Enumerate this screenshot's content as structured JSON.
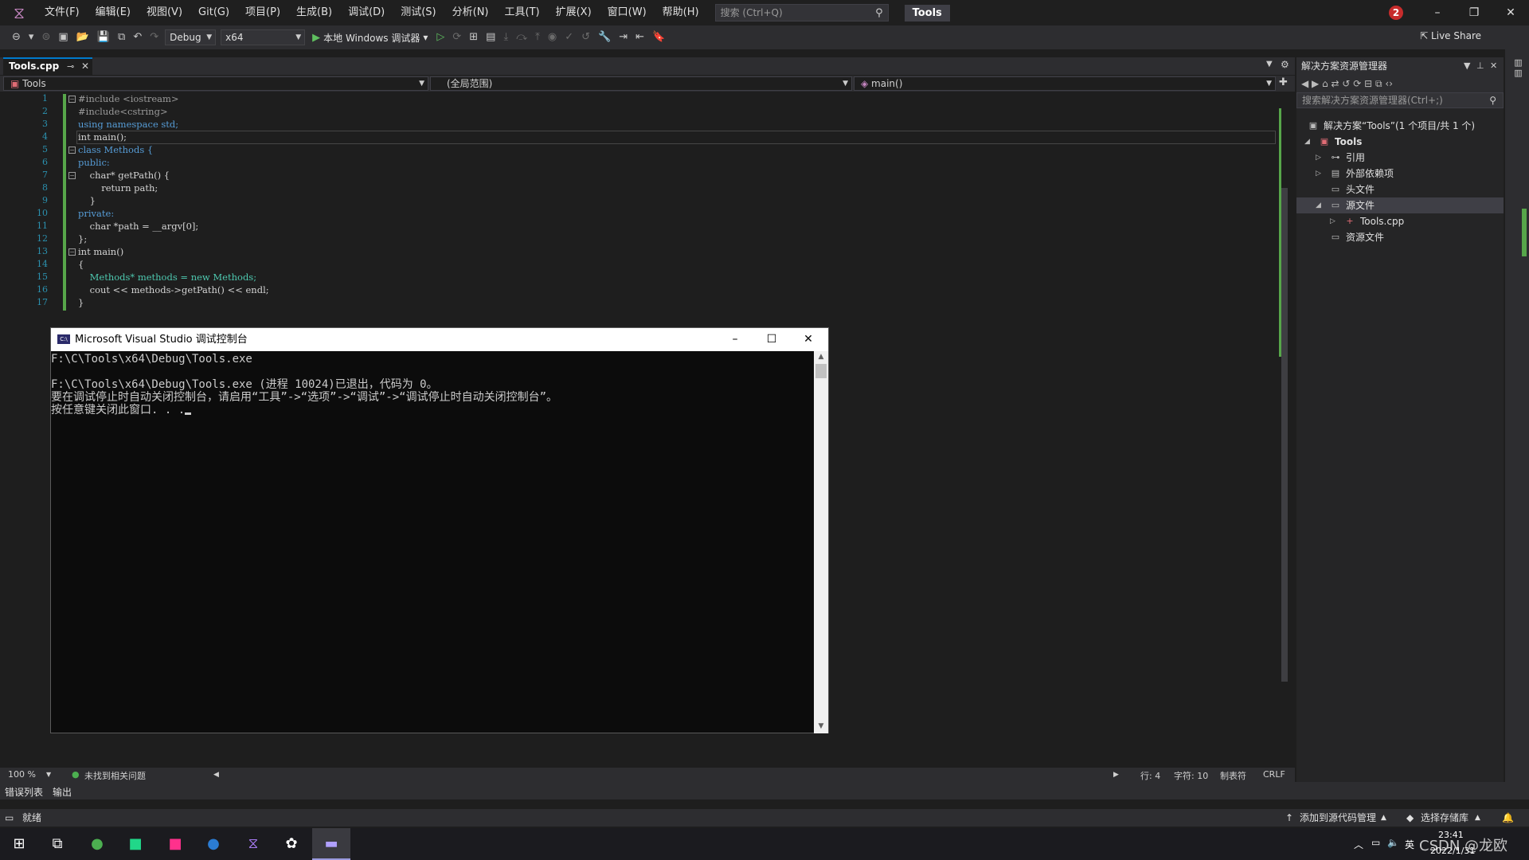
{
  "menubar": {
    "items": [
      "文件(F)",
      "编辑(E)",
      "视图(V)",
      "Git(G)",
      "项目(P)",
      "生成(B)",
      "调试(D)",
      "测试(S)",
      "分析(N)",
      "工具(T)",
      "扩展(X)",
      "窗口(W)",
      "帮助(H)"
    ],
    "search_placeholder": "搜索 (Ctrl+Q)",
    "solution_name": "Tools",
    "notification_count": "2"
  },
  "toolbar": {
    "config": "Debug",
    "platform": "x64",
    "run_label": "本地 Windows 调试器",
    "live_share": "Live Share"
  },
  "editor": {
    "tab_label": "Tools.cpp",
    "nav_project": "Tools",
    "nav_scope": "(全局范围)",
    "nav_member": "main()",
    "zoom": "100 %",
    "issues": "未找到相关问题",
    "line": "行: 4",
    "col": "字符: 10",
    "tabs": "制表符",
    "eol": "CRLF"
  },
  "code_lines": [
    {
      "n": "1",
      "t": "#include <iostream>"
    },
    {
      "n": "2",
      "t": "#include<cstring>"
    },
    {
      "n": "3",
      "t": "using namespace std;"
    },
    {
      "n": "4",
      "t": "int main();"
    },
    {
      "n": "5",
      "t": "class Methods {"
    },
    {
      "n": "6",
      "t": "public:"
    },
    {
      "n": "7",
      "t": "    char* getPath() {"
    },
    {
      "n": "8",
      "t": "        return path;"
    },
    {
      "n": "9",
      "t": "    }"
    },
    {
      "n": "10",
      "t": "private:"
    },
    {
      "n": "11",
      "t": "    char *path = __argv[0];"
    },
    {
      "n": "12",
      "t": "};"
    },
    {
      "n": "13",
      "t": "int main()"
    },
    {
      "n": "14",
      "t": "{"
    },
    {
      "n": "15",
      "t": "    Methods* methods = new Methods;"
    },
    {
      "n": "16",
      "t": "    cout << methods->getPath() << endl;"
    },
    {
      "n": "17",
      "t": "}"
    }
  ],
  "console": {
    "title": "Microsoft Visual Studio 调试控制台",
    "lines": [
      "F:\\C\\Tools\\x64\\Debug\\Tools.exe",
      "",
      "F:\\C\\Tools\\x64\\Debug\\Tools.exe (进程 10024)已退出，代码为 0。",
      "要在调试停止时自动关闭控制台，请启用“工具”->“选项”->“调试”->“调试停止时自动关闭控制台”。",
      "按任意键关闭此窗口. . ."
    ]
  },
  "solution_explorer": {
    "title": "解决方案资源管理器",
    "search_placeholder": "搜索解决方案资源管理器(Ctrl+;)",
    "items": [
      {
        "label": "解决方案“Tools”(1 个项目/共 1 个)"
      },
      {
        "label": "Tools"
      },
      {
        "label": "引用"
      },
      {
        "label": "外部依赖项"
      },
      {
        "label": "头文件"
      },
      {
        "label": "源文件"
      },
      {
        "label": "Tools.cpp"
      },
      {
        "label": "资源文件"
      }
    ]
  },
  "bottom": {
    "tab_errors": "错误列表",
    "tab_output": "输出",
    "status_ready": "就绪",
    "add_source_control": "添加到源代码管理",
    "select_repo": "选择存储库"
  },
  "taskbar": {
    "time": "23:41",
    "date": "2022/1/31",
    "ime": "英",
    "watermark": "CSDN @龙欧"
  }
}
